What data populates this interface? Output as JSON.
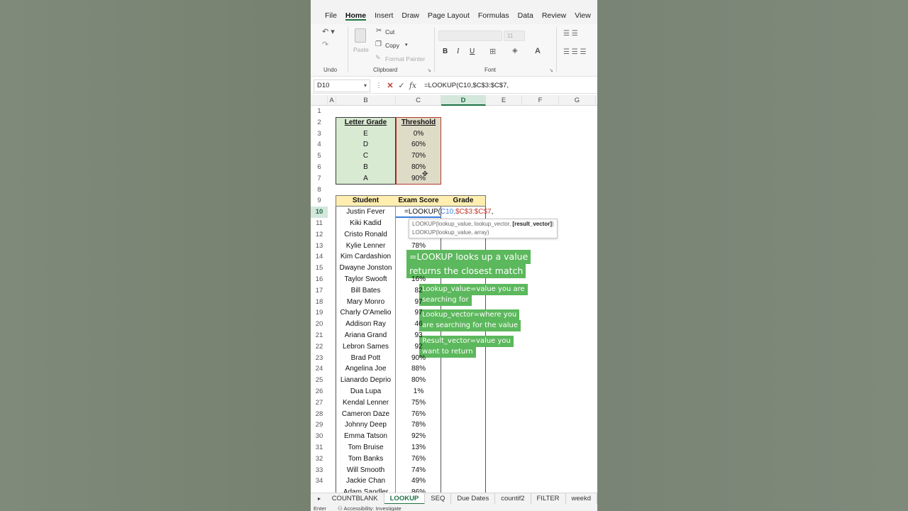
{
  "menu": [
    "File",
    "Home",
    "Insert",
    "Draw",
    "Page Layout",
    "Formulas",
    "Data",
    "Review",
    "View"
  ],
  "menu_active": "Home",
  "ribbon": {
    "undo_label": "Undo",
    "clipboard_label": "Clipboard",
    "font_label": "Font",
    "paste": "Paste",
    "cut": "Cut",
    "copy": "Copy",
    "format_painter": "Format Painter",
    "font_size": "11"
  },
  "formula_bar": {
    "cell_ref": "D10",
    "formula": "=LOOKUP(C10,$C$3:$C$7,"
  },
  "columns": [
    "A",
    "B",
    "C",
    "D",
    "E",
    "F",
    "G"
  ],
  "selected_column": "D",
  "rows": [
    "1",
    "2",
    "3",
    "4",
    "5",
    "6",
    "7",
    "8",
    "9",
    "10",
    "11",
    "12",
    "13",
    "14",
    "15",
    "16",
    "17",
    "18",
    "19",
    "20",
    "21",
    "22",
    "23",
    "24",
    "25",
    "26",
    "27",
    "28",
    "29",
    "30",
    "31",
    "32",
    "33",
    "34"
  ],
  "selected_row": "10",
  "grade_table": {
    "header_grade": "Letter Grade",
    "header_threshold": "Threshold",
    "grades": [
      "E",
      "D",
      "C",
      "B",
      "A"
    ],
    "thresholds": [
      "0%",
      "60%",
      "70%",
      "80%",
      "90%"
    ]
  },
  "student_table": {
    "header_student": "Student",
    "header_score": "Exam Score",
    "header_grade": "Grade",
    "students": [
      "Justin Fever",
      "Kiki Kadid",
      "Cristo Ronald",
      "Kylie Lenner",
      "Kim Cardashion",
      "Dwayne Jonston",
      "Taylor Swooft",
      "Bill Bates",
      "Mary Monro",
      "Charly O'Amelio",
      "Addison Ray",
      "Ariana Grand",
      "Lebron Sames",
      "Brad Pott",
      "Angelina Joe",
      "Lianardo Deprio",
      "Dua Lupa",
      "Kendal Lenner",
      "Cameron Daze",
      "Johnny Deep",
      "Emma Tatson",
      "Tom Bruise",
      "Tom Banks",
      "Will Smooth",
      "Jackie Chan",
      "Adam Sandler"
    ],
    "scores": [
      "",
      "",
      "",
      "78%",
      "",
      "",
      "16%",
      "82",
      "97",
      "97",
      "46",
      "93",
      "92",
      "90%",
      "88%",
      "80%",
      "1%",
      "75%",
      "76%",
      "78%",
      "92%",
      "13%",
      "76%",
      "74%",
      "49%",
      "86%"
    ],
    "editing_formula_prefix": "=LOOKUP(",
    "editing_formula_arg1": "C10,",
    "editing_formula_arg2": "$C$3:$C$7",
    "editing_formula_suffix": ","
  },
  "function_hint": {
    "line1_prefix": "LOOKUP(lookup_value, lookup_vector, ",
    "line1_bold": "[result_vector]",
    "line1_suffix": ")",
    "line2": "LOOKUP(lookup_value, array)"
  },
  "captions": {
    "main_line1": "=LOOKUP looks up a value",
    "main_line2": "returns the closest match",
    "lv_line1": "Lookup_value=value you are",
    "lv_line2": "searching for",
    "lvec_line1": "Lookup_vector=where you",
    "lvec_line2": "are searching for the value",
    "rv_line1": "Result_vector=value you",
    "rv_line2": "want to return"
  },
  "sheet_tabs": [
    "COUNTBLANK",
    "LOOKUP",
    "SEQ",
    "Due Dates",
    "countif2",
    "FILTER",
    "weekd"
  ],
  "active_tab": "LOOKUP",
  "status": {
    "mode": "Enter",
    "accessibility": "Accessibility: Investigate"
  },
  "colors": {
    "excel_green": "#1e7145",
    "grade_fill": "#d9ead3",
    "threshold_fill": "#dedbc7",
    "header_yellow": "#ffeeb0",
    "caption_green": "#5cb85c"
  }
}
